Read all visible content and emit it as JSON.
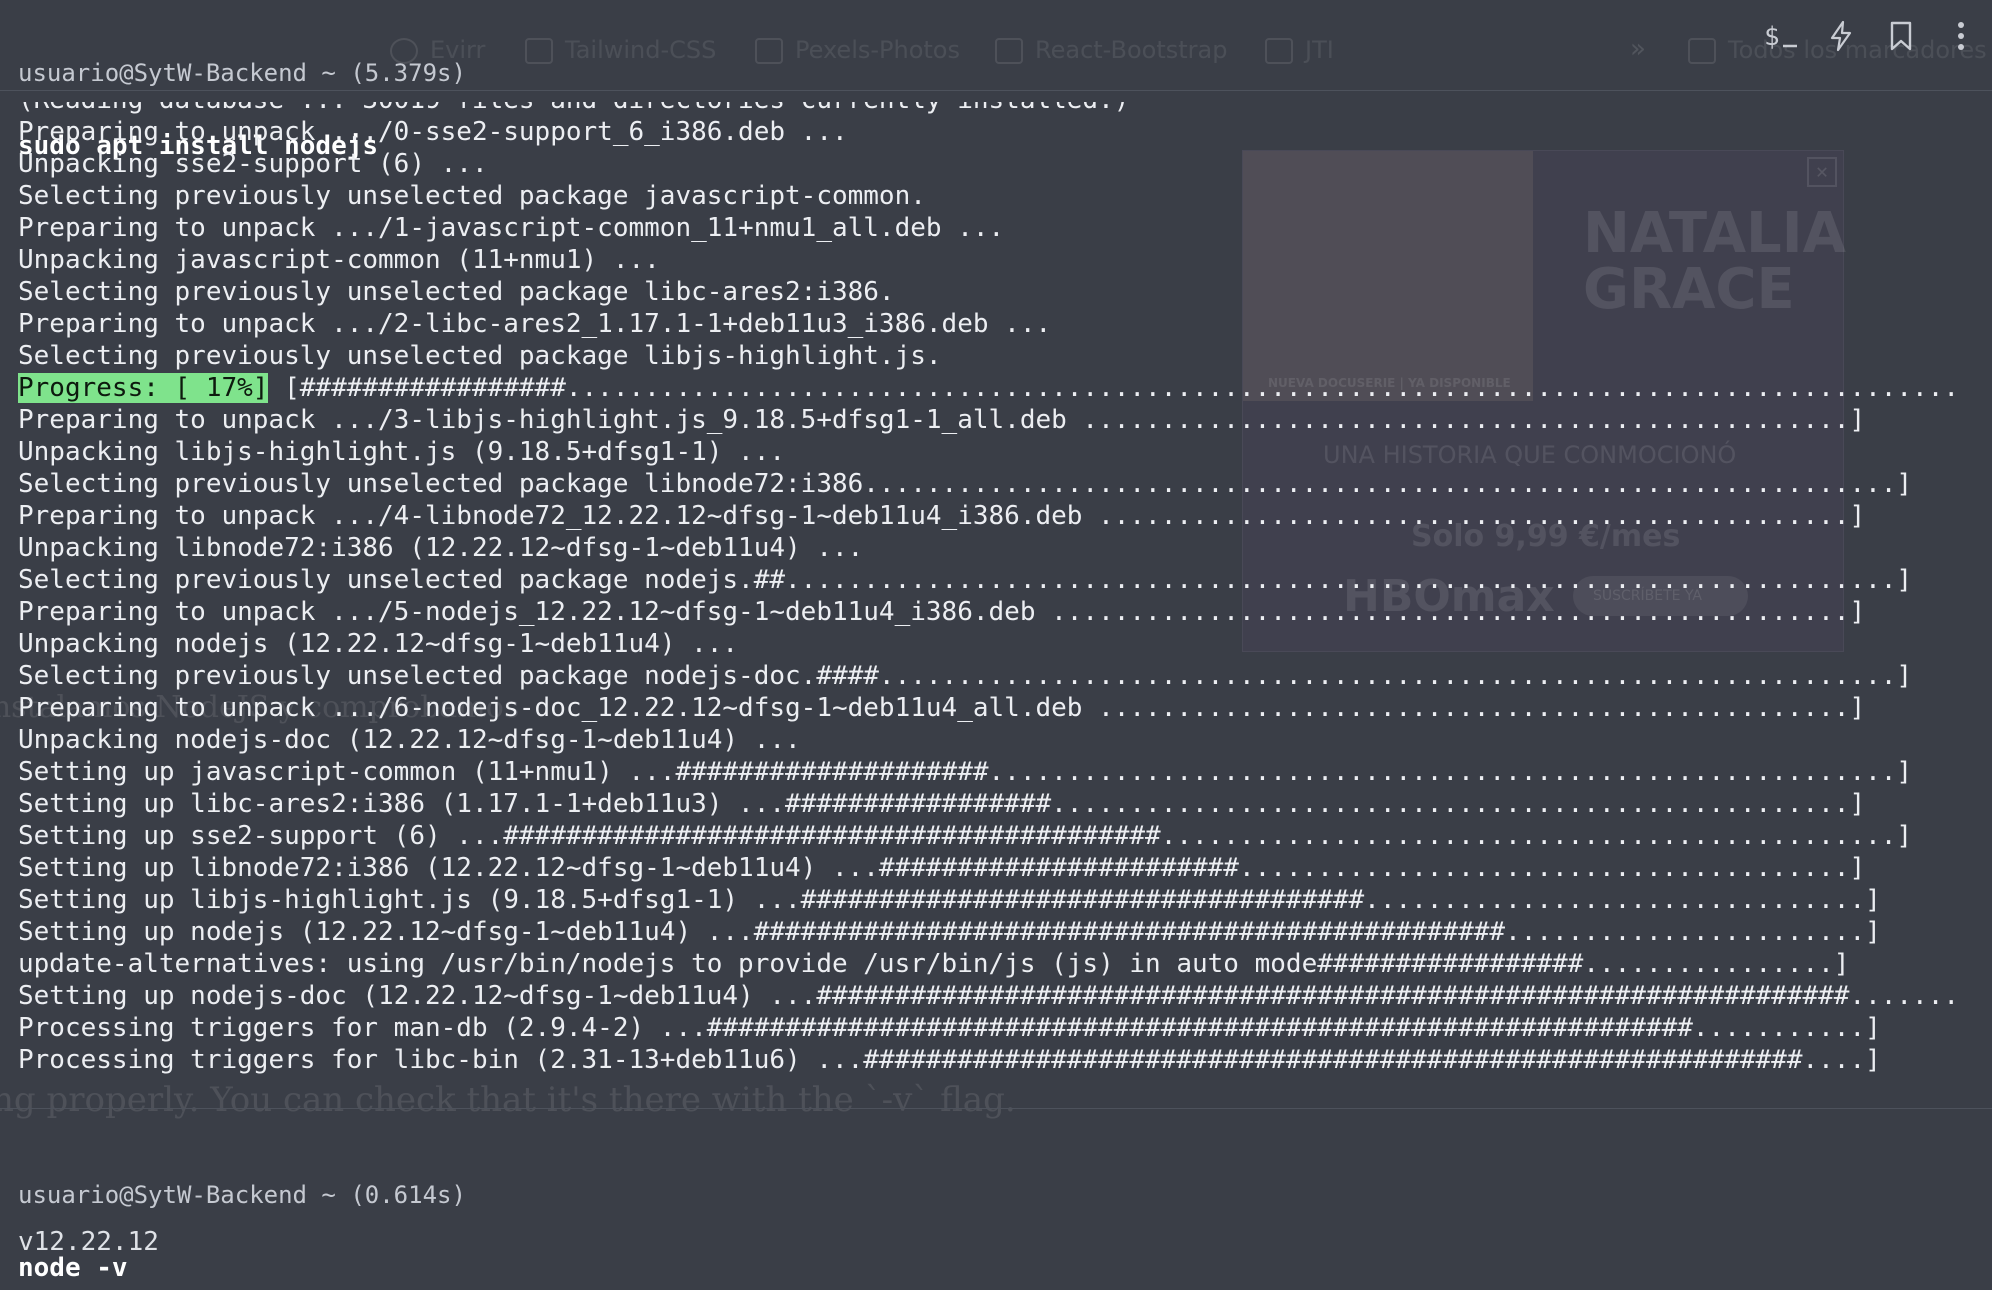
{
  "block1": {
    "prompt": "usuario@SytW-Backend ~ (5.379s)",
    "command": "sudo apt install nodejs",
    "partial_line": "(Reading database ... 30019 files and directories currently installed.)",
    "progress_label": "Progress: [ 17%]",
    "progress_bar": " [#################...........................................................................................]",
    "lines": [
      "Preparing to unpack .../0-sse2-support_6_i386.deb ...",
      "Unpacking sse2-support (6) ...",
      "Selecting previously unselected package javascript-common.",
      "Preparing to unpack .../1-javascript-common_11+nmu1_all.deb ...",
      "Unpacking javascript-common (11+nmu1) ...",
      "Selecting previously unselected package libc-ares2:i386.",
      "Preparing to unpack .../2-libc-ares2_1.17.1-1+deb11u3_i386.deb ...",
      "Selecting previously unselected package libjs-highlight.js.",
      "__PROGRESS__",
      "Preparing to unpack .../3-libjs-highlight.js_9.18.5+dfsg1-1_all.deb .................................................]",
      "Unpacking libjs-highlight.js (9.18.5+dfsg1-1) ...",
      "Selecting previously unselected package libnode72:i386..................................................................]",
      "Preparing to unpack .../4-libnode72_12.22.12~dfsg-1~deb11u4_i386.deb ................................................]",
      "Unpacking libnode72:i386 (12.22.12~dfsg-1~deb11u4) ...",
      "Selecting previously unselected package nodejs.##.......................................................................]",
      "Preparing to unpack .../5-nodejs_12.22.12~dfsg-1~deb11u4_i386.deb ...................................................]",
      "Unpacking nodejs (12.22.12~dfsg-1~deb11u4) ...",
      "Selecting previously unselected package nodejs-doc.####.................................................................]",
      "Preparing to unpack .../6-nodejs-doc_12.22.12~dfsg-1~deb11u4_all.deb ................................................]",
      "Unpacking nodejs-doc (12.22.12~dfsg-1~deb11u4) ...",
      "Setting up javascript-common (11+nmu1) ...####################..........................................................]",
      "Setting up libc-ares2:i386 (1.17.1-1+deb11u3) ...#################...................................................]",
      "Setting up sse2-support (6) ...##########################################...............................................]",
      "Setting up libnode72:i386 (12.22.12~dfsg-1~deb11u4) ...#######################.......................................]",
      "Setting up libjs-highlight.js (9.18.5+dfsg1-1) ...####################################................................]",
      "Setting up nodejs (12.22.12~dfsg-1~deb11u4) ...################################################.......................]",
      "update-alternatives: using /usr/bin/nodejs to provide /usr/bin/js (js) in auto mode#################................]",
      "Setting up nodejs-doc (12.22.12~dfsg-1~deb11u4) ...##################################################################.............]",
      "Processing triggers for man-db (2.9.4-2) ...###############################################################...........]",
      "Processing triggers for libc-bin (2.31-13+deb11u6) ...############################################################....]"
    ]
  },
  "block2": {
    "prompt": "usuario@SytW-Backend ~ (0.614s)",
    "command": "node -v",
    "output": "v12.22.12"
  },
  "toolbar": {
    "items": [
      {
        "name": "terminal-prompt-icon",
        "glyph": "$_"
      },
      {
        "name": "lightning-icon"
      },
      {
        "name": "bookmark-icon"
      },
      {
        "name": "more-vertical-icon"
      }
    ]
  },
  "background_page": {
    "bookmarks": [
      "Evirr",
      "Tailwind-CSS",
      "Pexels-Photos",
      "React-Bootstrap",
      "JTI",
      "Todos los marcadores"
    ],
    "ad_badge": "NUEVA DOCUSERIE | YA DISPONIBLE",
    "ad_title": "NATALIA GRACE",
    "ad_tagline": "UNA HISTORIA QUE CONMOCIONÓ",
    "ad_price": "Solo 9,99 €/mes",
    "ad_brand": "HBOmax",
    "ad_cta": "SUSCRÍBETE YA",
    "text_fragment_1": "Instalamos NodeJS y comprobamos",
    "text_fragment_2": "ng properly. You can check that it's there with the `-v` flag."
  },
  "colors": {
    "background": "#3a3e47",
    "progress_highlight": "#7fe38c",
    "text": "#eceef2"
  }
}
